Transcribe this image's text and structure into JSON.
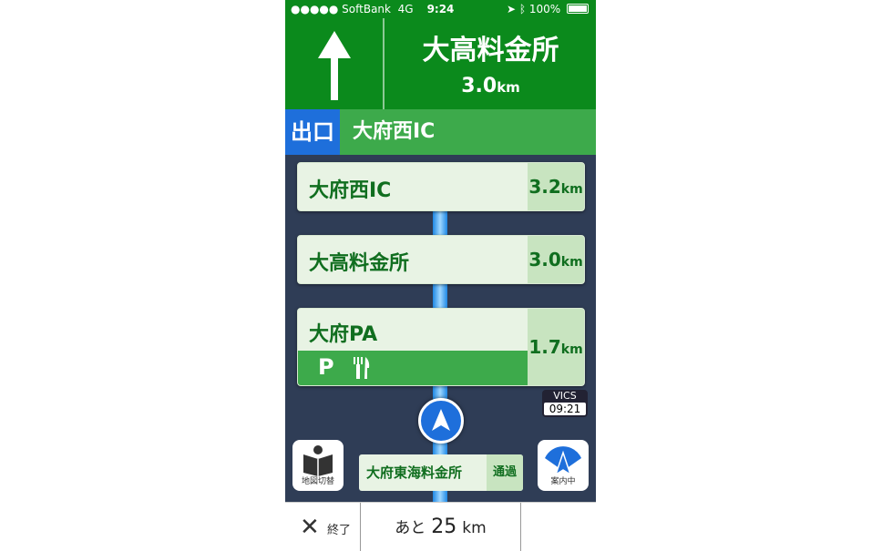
{
  "status_bar": {
    "carrier": "●●●●● SoftBank",
    "network": "4G",
    "time": "9:24",
    "battery": "100%"
  },
  "guidance": {
    "direction_icon": "straight-arrow-icon",
    "name": "大高料金所",
    "distance_value": "3.0",
    "distance_unit": "km"
  },
  "exit": {
    "badge": "出口",
    "name": "大府西IC"
  },
  "route_items": [
    {
      "name": "大府西IC",
      "distance": "3.2",
      "unit": "km"
    },
    {
      "name": "大高料金所",
      "distance": "3.0",
      "unit": "km"
    },
    {
      "name": "大府PA",
      "distance": "1.7",
      "unit": "km",
      "facilities": [
        "parking-icon",
        "restaurant-icon"
      ],
      "facilities_text": "P"
    }
  ],
  "vics": {
    "label": "VICS",
    "time": "09:21"
  },
  "next_toll": {
    "name": "大府東海料金所",
    "status": "通過"
  },
  "buttons": {
    "map_switch": "地図切替",
    "guidance": "案内中"
  },
  "bottom": {
    "end_label": "終了",
    "remain_prefix": "あと",
    "remain_value": "25",
    "remain_unit": "km"
  },
  "colors": {
    "highway_green": "#0b8a1c",
    "accent_blue": "#1e6fdb",
    "card_text": "#106e1f"
  }
}
